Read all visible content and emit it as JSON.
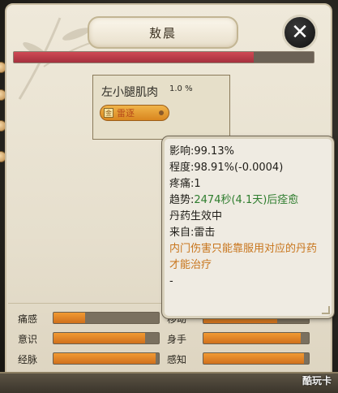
{
  "window": {
    "title": "敖晨"
  },
  "health": {
    "fraction": 0.8
  },
  "body_part": {
    "name": "左小腿肌肉",
    "percent": "1.0 %",
    "injury_label": "雷逐"
  },
  "tooltip": {
    "influence": "影响:99.13%",
    "degree": "程度:98.91%(-0.0004)",
    "pain": "疼痛:1",
    "trend": "趋势:",
    "trend_value": "2474秒(4.1天)后痊愈",
    "pill_effect": "丹药生效中",
    "source": "来自:雷击",
    "note": "内门伤害只能靠服用对应的丹药才能治疗",
    "dash": "-"
  },
  "stats": [
    {
      "label": "痛感",
      "value": 0.3
    },
    {
      "label": "意识",
      "value": 0.87
    },
    {
      "label": "经脉",
      "value": 0.97
    },
    {
      "label": "移动",
      "value": 0.7
    },
    {
      "label": "身手",
      "value": 0.92
    },
    {
      "label": "感知",
      "value": 0.95
    }
  ],
  "watermark": "酷玩卡",
  "colors": {
    "hp": "#b8343f",
    "stat_fill": "#e07f22",
    "trend": "#2e7d2e",
    "note": "#c8751c"
  }
}
